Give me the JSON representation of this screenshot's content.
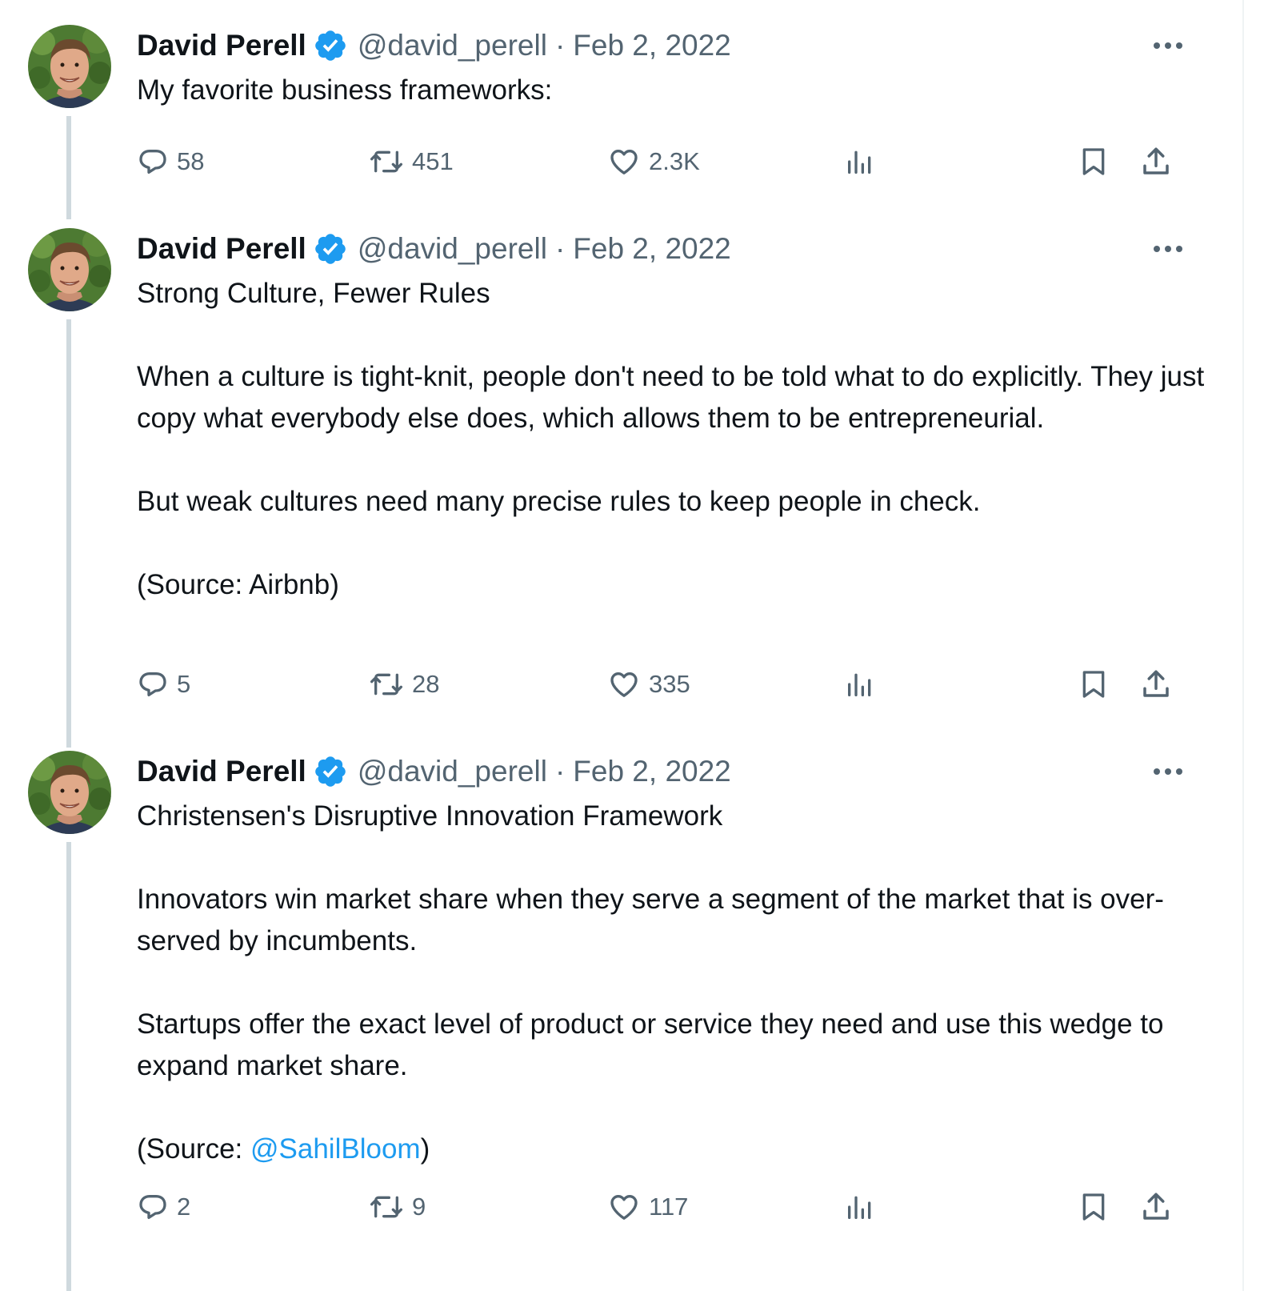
{
  "colors": {
    "text": "#0f1419",
    "muted": "#536471",
    "accent": "#1d9bf0",
    "thread_line": "#cfd9de"
  },
  "tweets": [
    {
      "author": "David Perell",
      "handle": "@david_perell",
      "separator": "·",
      "date": "Feb 2, 2022",
      "verified_icon": "verified-badge-icon",
      "paragraphs": [
        "My favorite business frameworks:"
      ],
      "counts": {
        "replies": "58",
        "retweets": "451",
        "likes": "2.3K"
      }
    },
    {
      "author": "David Perell",
      "handle": "@david_perell",
      "separator": "·",
      "date": "Feb 2, 2022",
      "verified_icon": "verified-badge-icon",
      "paragraphs": [
        "Strong Culture, Fewer Rules",
        "",
        "When a culture is tight-knit, people don't need to be told what to do explicitly. They just copy what everybody else does, which allows them to be entrepreneurial.",
        "",
        "But weak cultures need many precise rules to keep people in check.",
        "",
        "(Source: Airbnb)"
      ],
      "counts": {
        "replies": "5",
        "retweets": "28",
        "likes": "335"
      }
    },
    {
      "author": "David Perell",
      "handle": "@david_perell",
      "separator": "·",
      "date": "Feb 2, 2022",
      "verified_icon": "verified-badge-icon",
      "paragraphs": [
        "Christensen's Disruptive Innovation Framework",
        "",
        "Innovators win market share when they serve a segment of the market that is over-served by incumbents.",
        "",
        "Startups offer the exact level of product or service they need and use this wedge to expand market share.",
        ""
      ],
      "source_prefix": "(Source: ",
      "source_mention": "@SahilBloom",
      "source_suffix": ")",
      "counts": {
        "replies": "2",
        "retweets": "9",
        "likes": "117"
      }
    }
  ]
}
